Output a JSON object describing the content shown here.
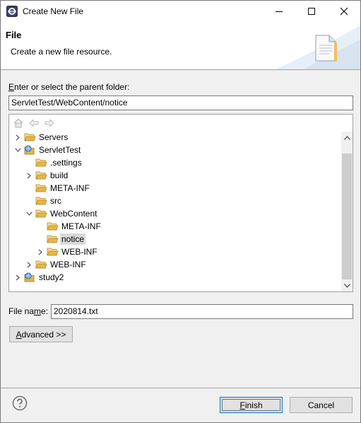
{
  "window": {
    "title": "Create New File"
  },
  "banner": {
    "title": "File",
    "description": "Create a new file resource."
  },
  "folder": {
    "label_mnemonic": "E",
    "label_rest": "nter or select the parent folder:",
    "value": "ServletTest/WebContent/notice"
  },
  "tree": {
    "items": [
      {
        "label": "Servers",
        "depth": 0,
        "expander": "collapsed",
        "icon": "folder-open-icon"
      },
      {
        "label": "ServletTest",
        "depth": 0,
        "expander": "expanded",
        "icon": "web-project-icon"
      },
      {
        "label": ".settings",
        "depth": 1,
        "expander": "none",
        "icon": "folder-open-icon"
      },
      {
        "label": "build",
        "depth": 1,
        "expander": "collapsed",
        "icon": "folder-open-icon"
      },
      {
        "label": "META-INF",
        "depth": 1,
        "expander": "none",
        "icon": "folder-open-icon"
      },
      {
        "label": "src",
        "depth": 1,
        "expander": "none",
        "icon": "folder-open-icon"
      },
      {
        "label": "WebContent",
        "depth": 1,
        "expander": "expanded",
        "icon": "folder-open-icon"
      },
      {
        "label": "META-INF",
        "depth": 2,
        "expander": "none",
        "icon": "folder-open-icon"
      },
      {
        "label": "notice",
        "depth": 2,
        "expander": "none",
        "icon": "folder-open-icon",
        "selected": true
      },
      {
        "label": "WEB-INF",
        "depth": 2,
        "expander": "collapsed",
        "icon": "folder-open-icon"
      },
      {
        "label": "WEB-INF",
        "depth": 1,
        "expander": "collapsed",
        "icon": "folder-open-icon"
      },
      {
        "label": "study2",
        "depth": 0,
        "expander": "collapsed",
        "icon": "web-project-icon"
      }
    ]
  },
  "file_name": {
    "label_before": "File na",
    "label_mnemonic": "m",
    "label_after": "e:",
    "value": "2020814.txt"
  },
  "buttons": {
    "advanced_mnemonic": "A",
    "advanced_rest": "dvanced >>",
    "finish_mnemonic": "F",
    "finish_rest": "inish",
    "cancel": "Cancel"
  },
  "colors": {
    "folder": "#e8b645",
    "selection": "#d9d9d9",
    "focus_border": "#0078d7"
  }
}
